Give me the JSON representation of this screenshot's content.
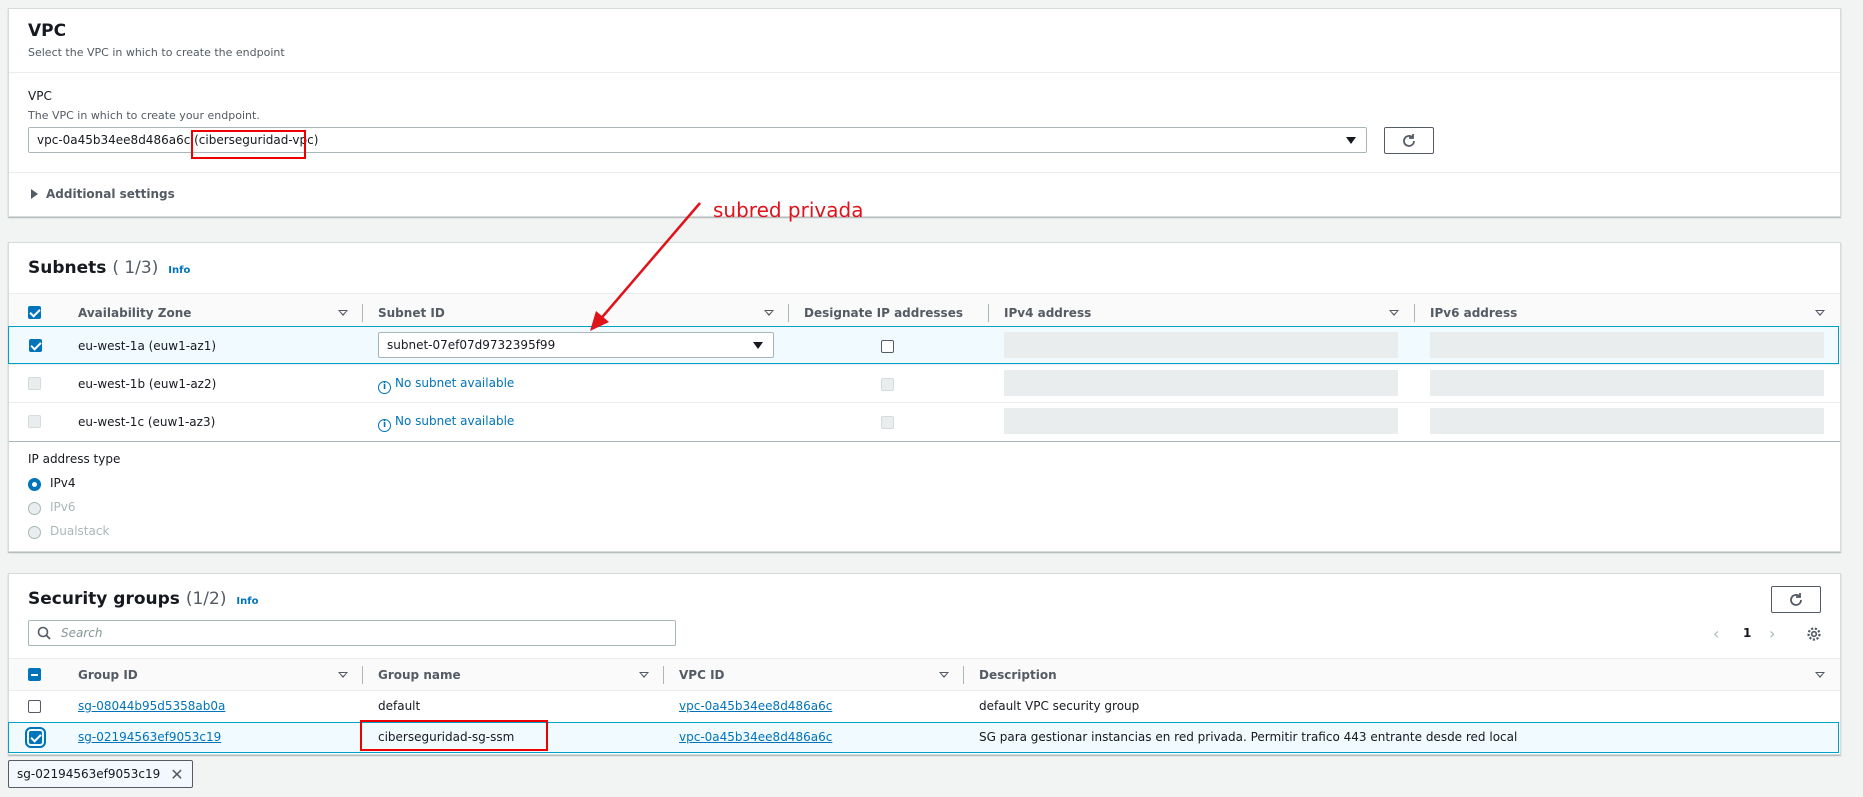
{
  "vpc": {
    "title": "VPC",
    "description": "Select the VPC in which to create the endpoint",
    "field_label": "VPC",
    "field_help": "The VPC in which to create your endpoint.",
    "selected_value": "vpc-0a45b34ee8d486a6c (ciberseguridad-vpc)",
    "additional_settings": "Additional settings"
  },
  "annotation": "subred privada",
  "subnets": {
    "title": "Subnets",
    "count": "( 1/3)",
    "info": "Info",
    "columns": [
      "Availability Zone",
      "Subnet ID",
      "Designate IP addresses",
      "IPv4 address",
      "IPv6 address"
    ],
    "rows": [
      {
        "az": "eu-west-1a (euw1-az1)",
        "subnet": "subnet-07ef07d9732395f99",
        "selected": true
      },
      {
        "az": "eu-west-1b (euw1-az2)",
        "subnet": "No subnet available",
        "selected": false
      },
      {
        "az": "eu-west-1c (euw1-az3)",
        "subnet": "No subnet available",
        "selected": false
      }
    ],
    "ip_type_label": "IP address type",
    "ip_options": [
      "IPv4",
      "IPv6",
      "Dualstack"
    ]
  },
  "security_groups": {
    "title": "Security groups",
    "count": "(1/2)",
    "info": "Info",
    "search_placeholder": "Search",
    "page": "1",
    "columns": [
      "Group ID",
      "Group name",
      "VPC ID",
      "Description"
    ],
    "rows": [
      {
        "id": "sg-08044b95d5358ab0a",
        "name": "default",
        "vpc": "vpc-0a45b34ee8d486a6c",
        "description": "default VPC security group",
        "selected": false
      },
      {
        "id": "sg-02194563ef9053c19",
        "name": "ciberseguridad-sg-ssm",
        "vpc": "vpc-0a45b34ee8d486a6c",
        "description": "SG para gestionar instancias en red privada. Permitir trafico 443 entrante desde red local",
        "selected": true
      }
    ],
    "token": "sg-02194563ef9053c19"
  }
}
